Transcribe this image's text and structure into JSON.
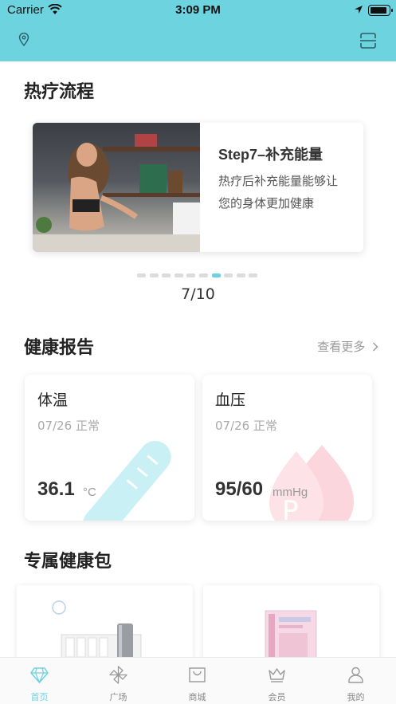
{
  "status_bar": {
    "carrier": "Carrier",
    "time": "3:09 PM"
  },
  "colors": {
    "accent": "#6dd3df",
    "header_bg": "#6dd3df",
    "pressure_pink": "#f7c6cf",
    "temp_cyan": "#bfeef2"
  },
  "header": {
    "left_icon": "location-pin-icon",
    "right_icon": "scan-icon"
  },
  "therapy": {
    "title": "热疗流程",
    "slide": {
      "step": "Step7–补充能量",
      "desc_line1": "热疗后补充能量能够让",
      "desc_line2": "您的身体更加健康"
    },
    "page_total": 10,
    "page_current": 7,
    "counter": "7/10"
  },
  "health_report": {
    "title": "健康报告",
    "more": "查看更多",
    "cards": [
      {
        "name": "体温",
        "date": "07/26 正常",
        "value": "36.1",
        "unit": "°C",
        "icon": "thermometer-icon"
      },
      {
        "name": "血压",
        "date": "07/26 正常",
        "value": "95/60",
        "unit": "mmHg",
        "icon": "blood-drop-icon"
      }
    ]
  },
  "packages": {
    "title": "专属健康包"
  },
  "tabs": [
    {
      "label": "首页",
      "icon": "diamond-icon",
      "active": true
    },
    {
      "label": "广场",
      "icon": "pinwheel-icon",
      "active": false
    },
    {
      "label": "商城",
      "icon": "shopping-bag-icon",
      "active": false
    },
    {
      "label": "会员",
      "icon": "crown-icon",
      "active": false
    },
    {
      "label": "我的",
      "icon": "user-icon",
      "active": false
    }
  ]
}
